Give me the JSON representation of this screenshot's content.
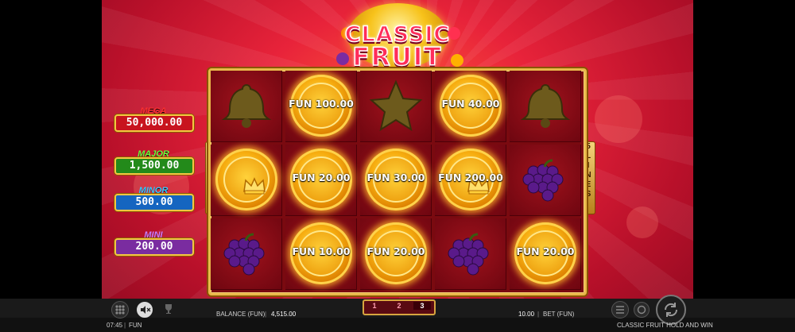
{
  "game": {
    "logo_line1": "CLASSIC",
    "logo_line2": "FRUIT"
  },
  "jackpots": [
    {
      "label": "MEGA",
      "value": "50,000.00",
      "label_color": "#ff3030",
      "box_color": "#c8141e"
    },
    {
      "label": "MAJOR",
      "value": "1,500.00",
      "label_color": "#6cff3a",
      "box_color": "#238a1a"
    },
    {
      "label": "MINOR",
      "value": "500.00",
      "label_color": "#3ac8ff",
      "box_color": "#1565c0"
    },
    {
      "label": "MINI",
      "value": "200.00",
      "label_color": "#d07cff",
      "box_color": "#7a2ca0"
    }
  ],
  "lines_tag": {
    "number": "5",
    "word": "LINES"
  },
  "reels": [
    [
      {
        "type": "bell"
      },
      {
        "type": "coin",
        "text": "FUN 100.00"
      },
      {
        "type": "star"
      },
      {
        "type": "coin",
        "text": "FUN 40.00"
      },
      {
        "type": "bell"
      }
    ],
    [
      {
        "type": "crown"
      },
      {
        "type": "coin",
        "text": "FUN 20.00"
      },
      {
        "type": "coin",
        "text": "FUN 30.00"
      },
      {
        "type": "coin",
        "text": "FUN 200.00",
        "crown": true
      },
      {
        "type": "grapes"
      }
    ],
    [
      {
        "type": "grapes"
      },
      {
        "type": "coin",
        "text": "FUN 10.00"
      },
      {
        "type": "coin",
        "text": "FUN 20.00"
      },
      {
        "type": "grapes"
      },
      {
        "type": "coin",
        "text": "FUN 20.00"
      }
    ]
  ],
  "bottom": {
    "balance_label": "BALANCE (FUN)",
    "balance_value": "4,515.00",
    "pages": [
      "1",
      "2",
      "3"
    ],
    "active_page": 3,
    "bet_value": "10.00",
    "bet_label": "BET (FUN)",
    "time": "07:45",
    "mode": "FUN",
    "game_title": "CLASSIC FRUIT HOLD AND WIN"
  },
  "colors": {
    "accent_gold": "#e9b84a",
    "background_red": "#e8233a"
  }
}
